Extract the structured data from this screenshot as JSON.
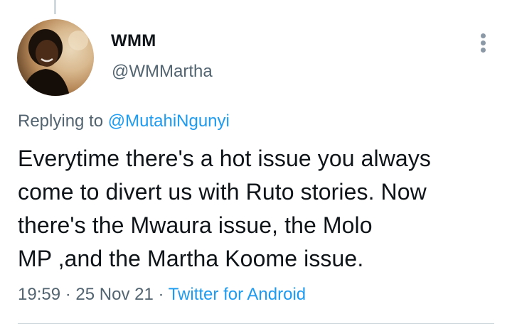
{
  "author": {
    "name": "WMM",
    "handle": "@WMMartha"
  },
  "reply": {
    "prefix": "Replying to",
    "mention": "@MutahiNgunyi"
  },
  "tweet": {
    "lines": [
      "Everytime there's a hot issue you always",
      "come to divert us with Ruto stories. Now",
      "there's the Mwaura issue, the Molo",
      "MP ,and the Martha Koome issue."
    ]
  },
  "meta": {
    "time": "19:59",
    "separator": "·",
    "date": "25 Nov 21",
    "source": "Twitter for Android"
  },
  "icons": {
    "more": "more-vertical-icon"
  },
  "colors": {
    "text": "#0f1419",
    "secondary": "#536471",
    "accent": "#1d9bf0",
    "divider": "#cfd9de"
  }
}
